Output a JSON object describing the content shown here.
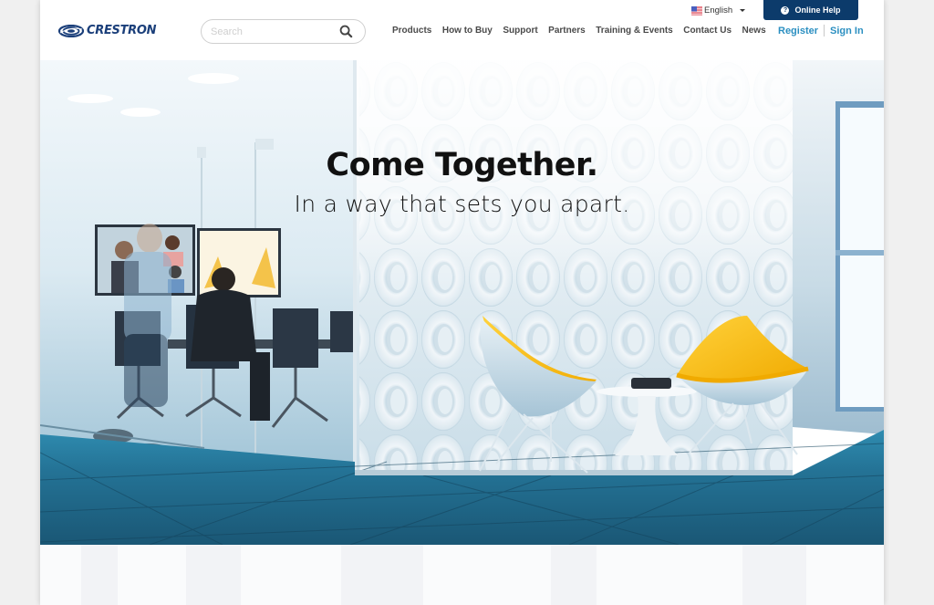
{
  "brand": {
    "name": "CRESTRON",
    "logo_color": "#1b3f7a"
  },
  "search": {
    "placeholder": "Search",
    "value": "",
    "icon": "search-icon"
  },
  "utility": {
    "language": {
      "label": "English",
      "flag": "us-flag-icon"
    },
    "online_help": {
      "label": "Online Help",
      "icon": "help-circle-icon",
      "color": "#0c3b6b"
    }
  },
  "nav": {
    "items": [
      {
        "label": "Products"
      },
      {
        "label": "How to Buy"
      },
      {
        "label": "Support"
      },
      {
        "label": "Partners"
      },
      {
        "label": "Training & Events"
      },
      {
        "label": "Contact Us"
      },
      {
        "label": "News"
      }
    ]
  },
  "auth": {
    "register": "Register",
    "sign_in": "Sign In",
    "link_color": "#2b8fc1"
  },
  "hero": {
    "title": "Come Together.",
    "subtitle": "In a way that sets you apart.",
    "image_description": "Modern office lobby with yellow egg-style chairs, white circular wall panels, glass-walled conference room with video call display"
  }
}
